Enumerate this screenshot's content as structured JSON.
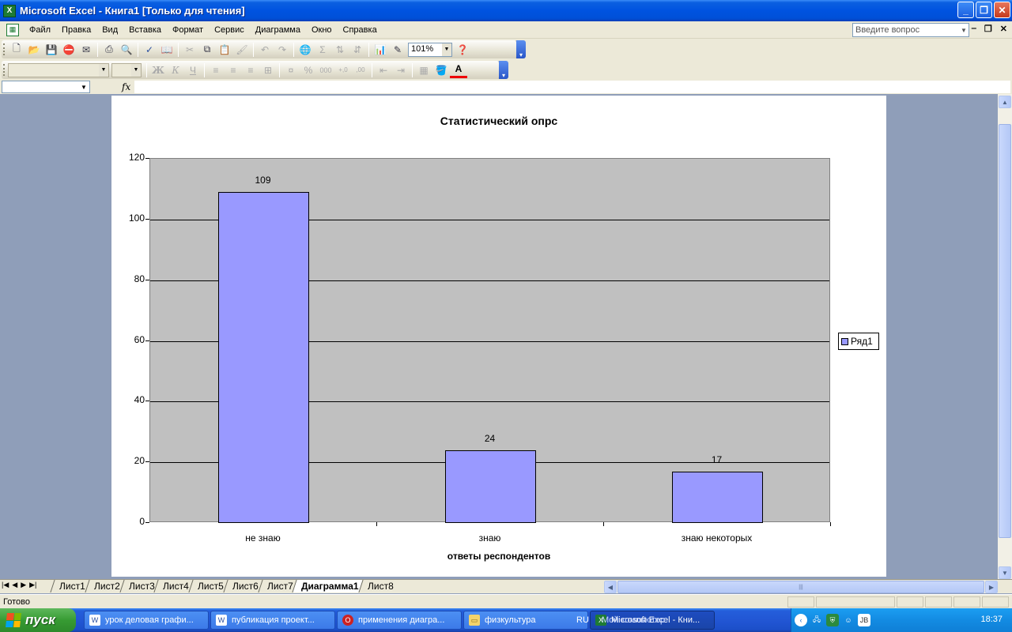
{
  "window": {
    "title": "Microsoft Excel - Книга1  [Только для чтения]",
    "controls": [
      "minimize-icon",
      "restore-icon",
      "close-icon"
    ]
  },
  "menu": {
    "items": [
      "Файл",
      "Правка",
      "Вид",
      "Вставка",
      "Формат",
      "Сервис",
      "Диаграмма",
      "Окно",
      "Справка"
    ],
    "ask_placeholder": "Введите вопрос"
  },
  "toolbar": {
    "zoom": "101%",
    "format_bold": "Ж",
    "format_italic": "К",
    "format_underline": "Ч",
    "sigma": "Σ",
    "fx": "fx",
    "percent": "%",
    "thousands": "000",
    "dec_inc": "+,0",
    "dec_dec": ",00",
    "font_color": "A"
  },
  "chart_data": {
    "type": "bar",
    "title": "Статистический опрс",
    "categories": [
      "не знаю",
      "знаю",
      "знаю некоторых"
    ],
    "series": [
      {
        "name": "Ряд1",
        "values": [
          109,
          24,
          17
        ]
      }
    ],
    "xlabel": "ответы респондентов",
    "ylabel": "",
    "ylim": [
      0,
      120
    ],
    "yticks": [
      0,
      20,
      40,
      60,
      80,
      100,
      120
    ],
    "data_labels": [
      "109",
      "24",
      "17"
    ],
    "grid": true,
    "legend": "right",
    "colors": {
      "bar": "#9999ff",
      "plot_bg": "#c0c0c0"
    }
  },
  "sheets": {
    "tabs": [
      "Лист1",
      "Лист2",
      "Лист3",
      "Лист4",
      "Лист5",
      "Лист6",
      "Лист7",
      "Диаграмма1",
      "Лист8"
    ],
    "active": "Диаграмма1"
  },
  "status": {
    "text": "Готово"
  },
  "taskbar": {
    "start_label": "пуск",
    "tasks": [
      {
        "label": "урок деловая графи...",
        "icon": "word-icon"
      },
      {
        "label": "публикация проект...",
        "icon": "word-icon"
      },
      {
        "label": "применения диагра...",
        "icon": "opera-icon"
      },
      {
        "label": "физкультура",
        "icon": "folder-icon"
      },
      {
        "label": "Microsoft Excel - Кни...",
        "icon": "excel-icon"
      }
    ],
    "lang": "RU",
    "my_computer": "Мой компьютер",
    "clock": "18:37"
  }
}
